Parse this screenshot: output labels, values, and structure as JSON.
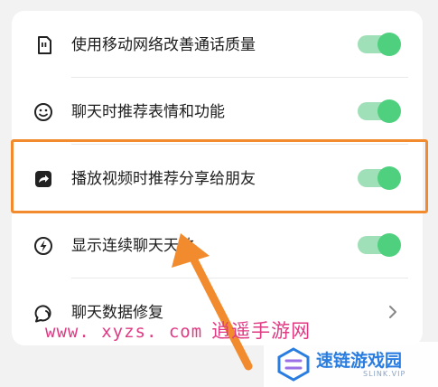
{
  "settings": {
    "items": [
      {
        "label": "使用移动网络改善通话质量",
        "icon": "sim-card-icon",
        "control": "toggle",
        "on": true
      },
      {
        "label": "聊天时推荐表情和功能",
        "icon": "smiley-icon",
        "control": "toggle",
        "on": true
      },
      {
        "label": "播放视频时推荐分享给朋友",
        "icon": "share-icon",
        "control": "toggle",
        "on": true
      },
      {
        "label": "显示连续聊天天数",
        "icon": "lightning-icon",
        "control": "toggle",
        "on": true
      },
      {
        "label": "聊天数据修复",
        "icon": "chat-repair-icon",
        "control": "chevron"
      }
    ]
  },
  "colors": {
    "toggle_on": "#4fd07e",
    "toggle_track": "#9fe0b8",
    "highlight": "#f28b2d",
    "watermark": "#e03a83",
    "logo": "#2a7de0"
  },
  "watermark": {
    "url": "www. xyzs. com",
    "site": "逍遥手游网"
  },
  "logo": {
    "name": "速链游戏园",
    "sub": "SLINK.VIP"
  }
}
